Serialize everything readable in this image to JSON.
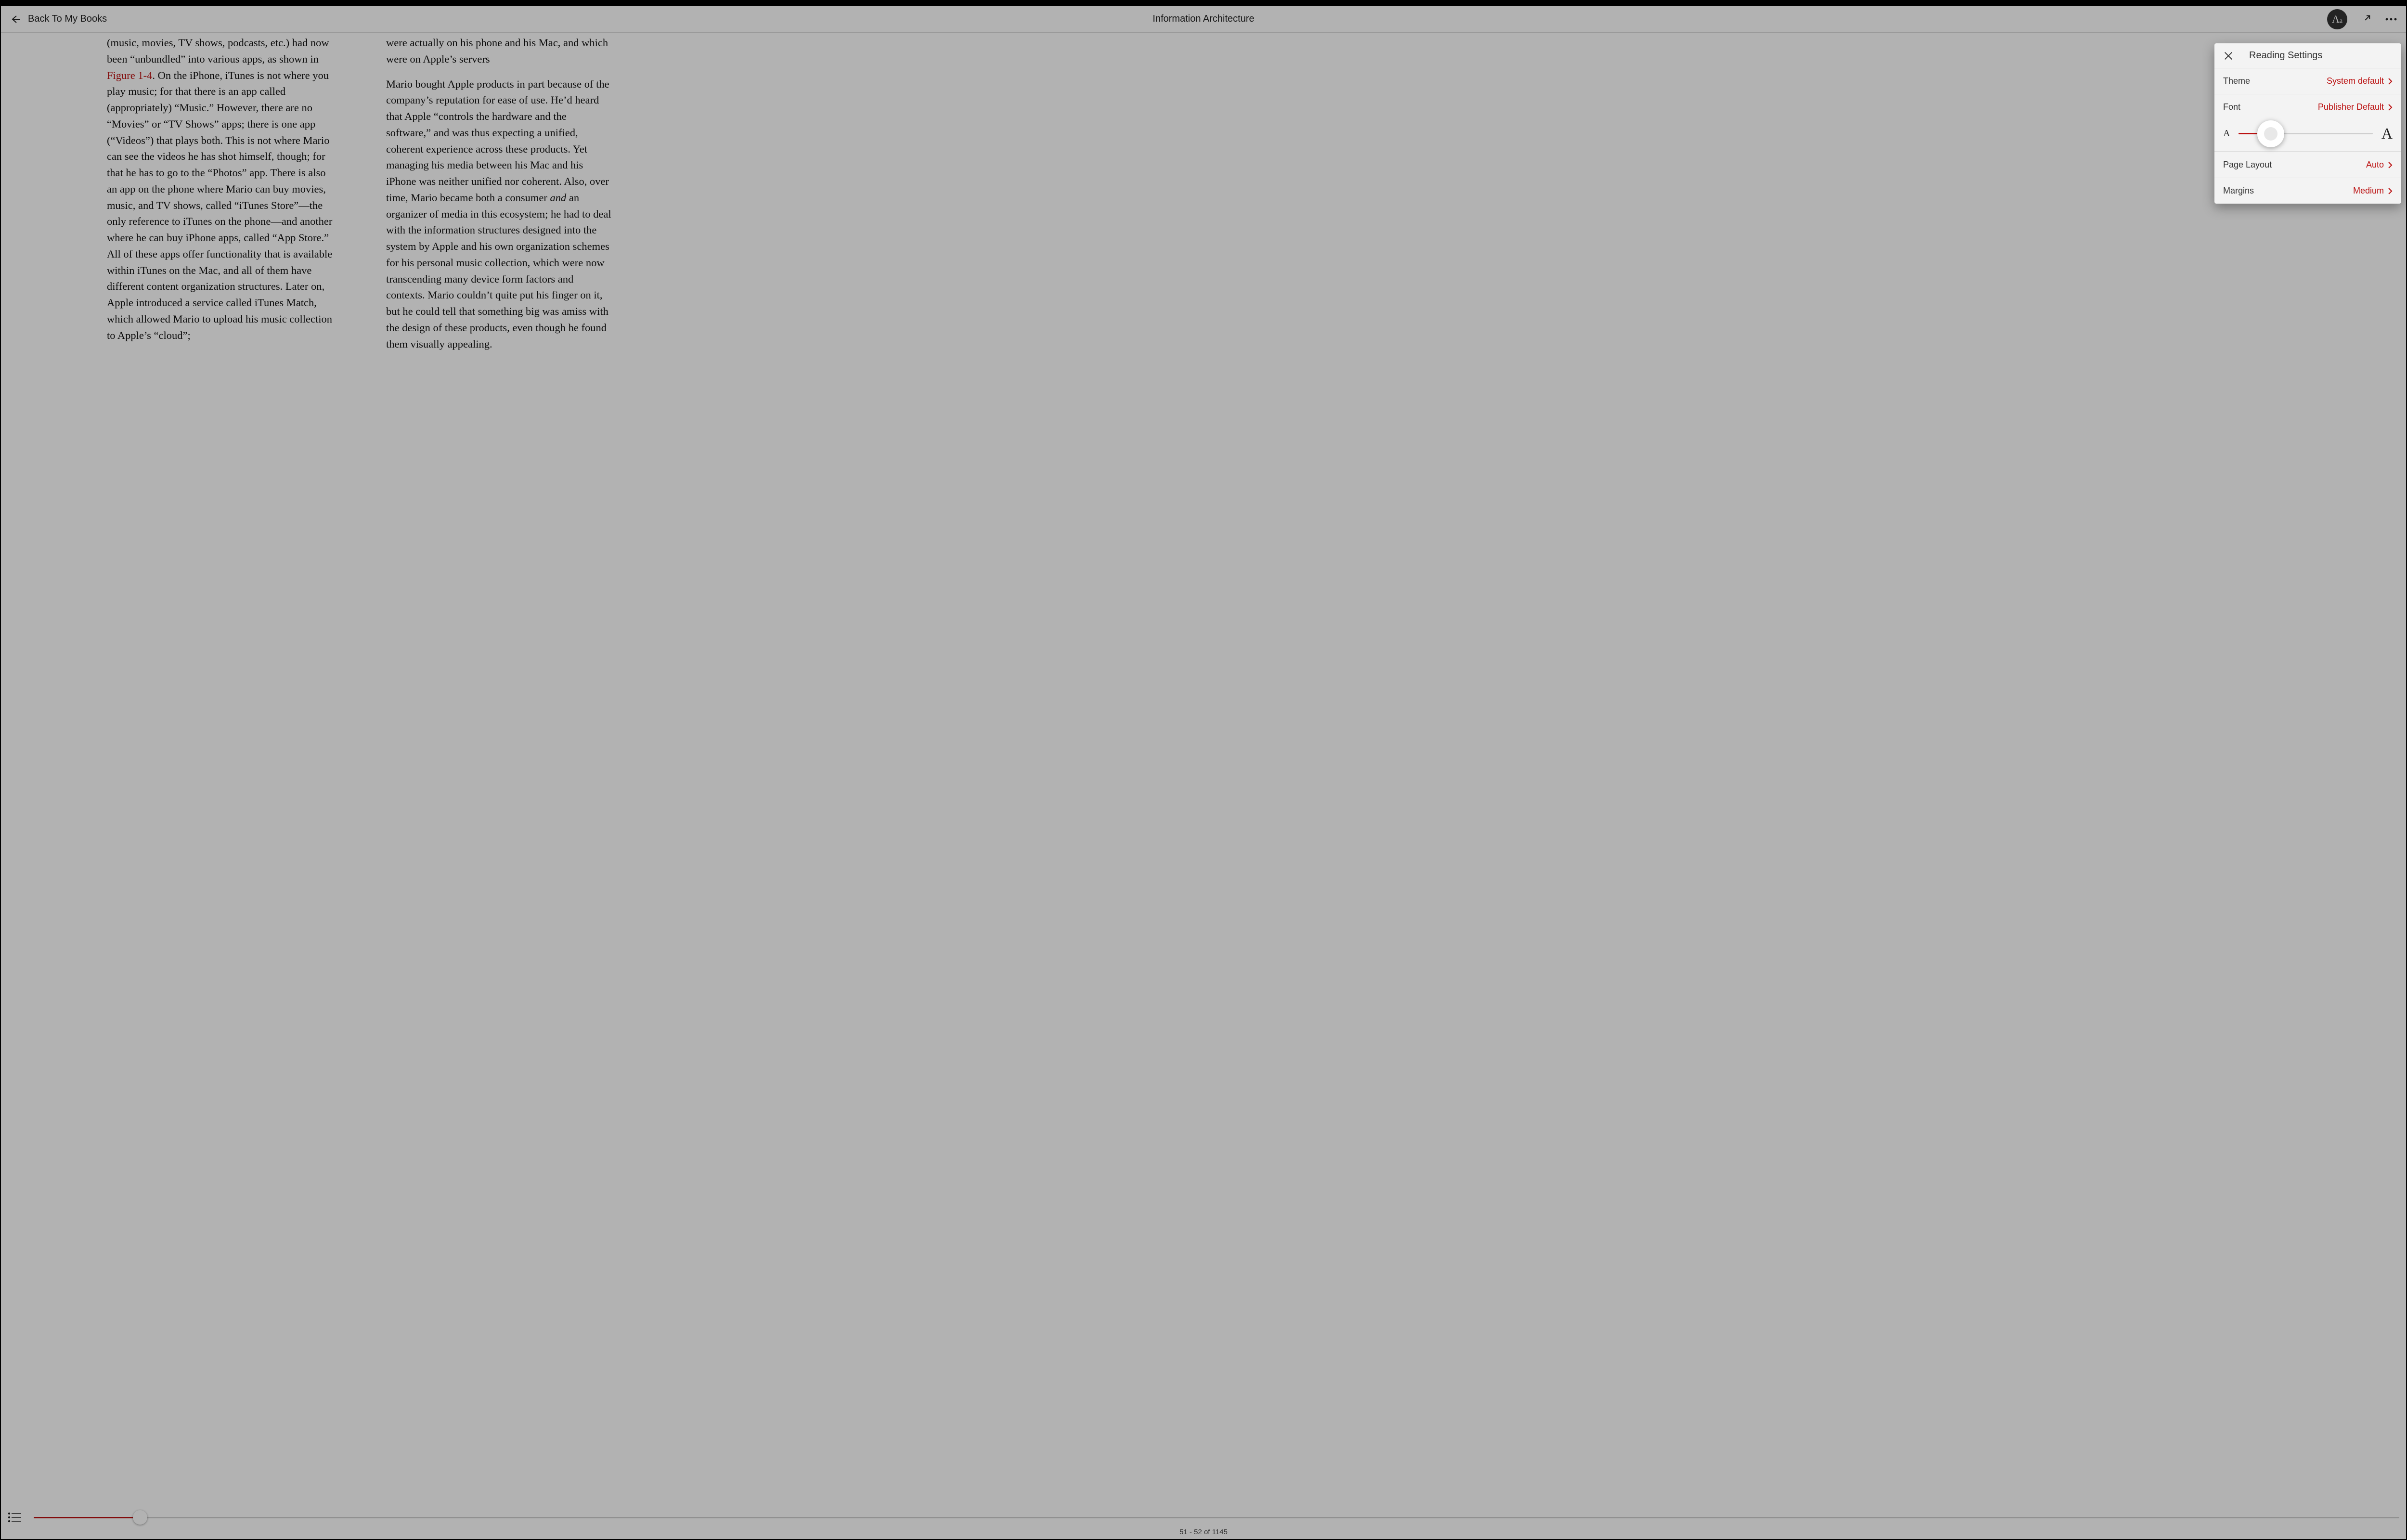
{
  "header": {
    "back_label": "Back To My Books",
    "title": "Information Architecture"
  },
  "content": {
    "left_col_pre": "(music, movies, TV shows, podcasts, etc.) had now been “unbundled” into various apps, as shown in ",
    "left_col_figref": "Figure 1-4",
    "left_col_post": ". On the iPhone, iTunes is not where you play music; for that there is an app called (appropriately) “Music.” However, there are no “Movies” or “TV Shows” apps; there is one app (“Videos”) that plays both. This is not where Mario can see the videos he has shot himself, though; for that he has to go to the “Photos” app. There is also an app on the phone where Mario can buy movies, music, and TV shows, called “iTunes Store”—the only reference to iTunes on the phone—and another where he can buy iPhone apps, called “App Store.” All of these apps offer functionality that is available within iTunes on the Mac, and all of them have different content organization structures. Later on, Apple introduced a service called iTunes Match, which allowed Mario to upload his music collection to Apple’s “cloud”;",
    "right_col_para1": "were actually on his phone and his Mac, and which were on Apple’s servers",
    "right_col_para2_pre": "Mario bought Apple products in part because of the company’s reputation for ease of use. He’d heard that Apple “controls the hardware and the software,” and was thus expecting a unified, coherent experience across these products. Yet managing his media between his Mac and his iPhone was neither unified nor coherent. Also, over time, Mario became both a consumer ",
    "right_col_em": "and",
    "right_col_para2_post": " an organizer of media in this ecosystem; he had to deal with the information structures designed into the system by Apple and his own organization schemes for his personal music collection, which were now transcending many device form factors and contexts. Mario couldn’t quite put his finger on it, but he could tell that something big was amiss with the design of these products, even though he found them visually appealing."
  },
  "footer": {
    "page_indicator": "51 - 52 of 1145",
    "progress_percent": 4.5
  },
  "settings": {
    "title": "Reading Settings",
    "theme_label": "Theme",
    "theme_value": "System default",
    "font_label": "Font",
    "font_value": "Publisher Default",
    "font_size_percent": 24,
    "layout_label": "Page Layout",
    "layout_value": "Auto",
    "margins_label": "Margins",
    "margins_value": "Medium"
  }
}
